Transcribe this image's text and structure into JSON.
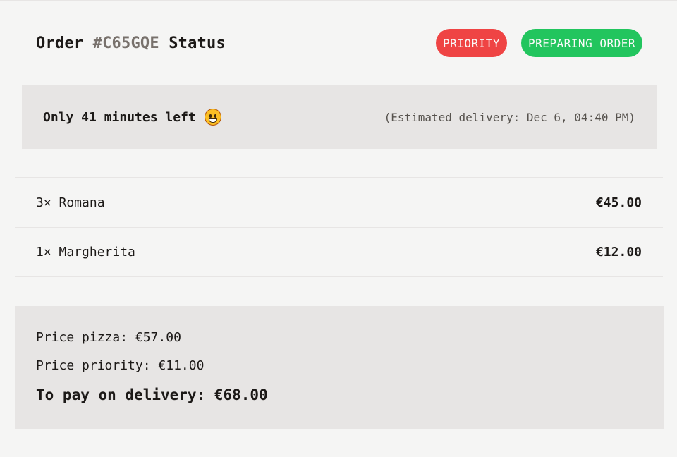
{
  "header": {
    "title_prefix": "Order ",
    "order_id": "#C65GQE",
    "title_suffix": " Status",
    "badge_priority": "PRIORITY",
    "badge_status": "PREPARING ORDER",
    "colors": {
      "priority": "#ef4444",
      "status": "#22c55e"
    }
  },
  "delivery": {
    "time_left": "Only 41 minutes left",
    "emoji": "grinning-face-icon",
    "estimate": "(Estimated delivery: Dec 6, 04:40 PM)"
  },
  "items": [
    {
      "name": "3× Romana",
      "price": "€45.00"
    },
    {
      "name": "1× Margherita",
      "price": "€12.00"
    }
  ],
  "summary": {
    "price_pizza": "Price pizza: €57.00",
    "price_priority": "Price priority: €11.00",
    "total": "To pay on delivery: €68.00"
  }
}
